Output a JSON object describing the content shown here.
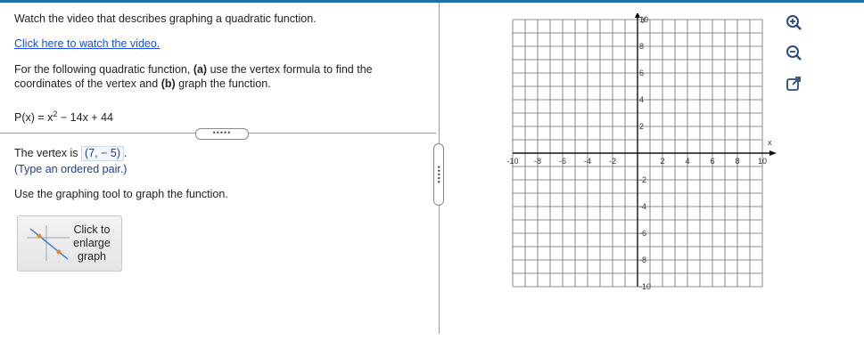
{
  "instructions": {
    "video_line": "Watch the video that describes graphing a quadratic function.",
    "video_link": "Click here to watch the video.",
    "task_line1_pre": "For the following quadratic function, ",
    "task_a": "(a)",
    "task_line1_post": " use the vertex formula to find the",
    "task_line2_pre": "coordinates of the vertex and ",
    "task_b": "(b)",
    "task_line2_post": " graph the function.",
    "fn_lhs": "P(x) = x",
    "fn_exp": "2",
    "fn_rhs": " − 14x + 44"
  },
  "splitter": {
    "horizontal_label": "•••••",
    "vertical_label": "•••••"
  },
  "answer": {
    "vertex_prefix": "The vertex is ",
    "vertex_value": "(7, − 5)",
    "vertex_suffix": ".",
    "hint": "(Type an ordered pair.)"
  },
  "graph_tool": {
    "instruction": "Use the graphing tool to graph the function.",
    "enlarge_label": "Click to enlarge graph"
  },
  "axes": {
    "x_label": "x",
    "y_label": "y",
    "x_min": -10,
    "x_max": 10,
    "y_min": -10,
    "y_max": 10,
    "x_ticks": [
      "-10",
      "-8",
      "-6",
      "-4",
      "-2",
      "2",
      "4",
      "6",
      "8",
      "10"
    ],
    "y_ticks": [
      "10",
      "8",
      "6",
      "4",
      "2",
      "-2",
      "-4",
      "-6",
      "-8",
      "-10"
    ],
    "grid": true
  },
  "toolbar": {
    "zoom_in_icon": "zoom-in-icon",
    "zoom_out_icon": "zoom-out-icon",
    "popout_icon": "external-link-icon"
  },
  "colors": {
    "link": "#1a4fd6",
    "answer_text": "#1f3f8f",
    "accent": "#1f6fa8"
  }
}
